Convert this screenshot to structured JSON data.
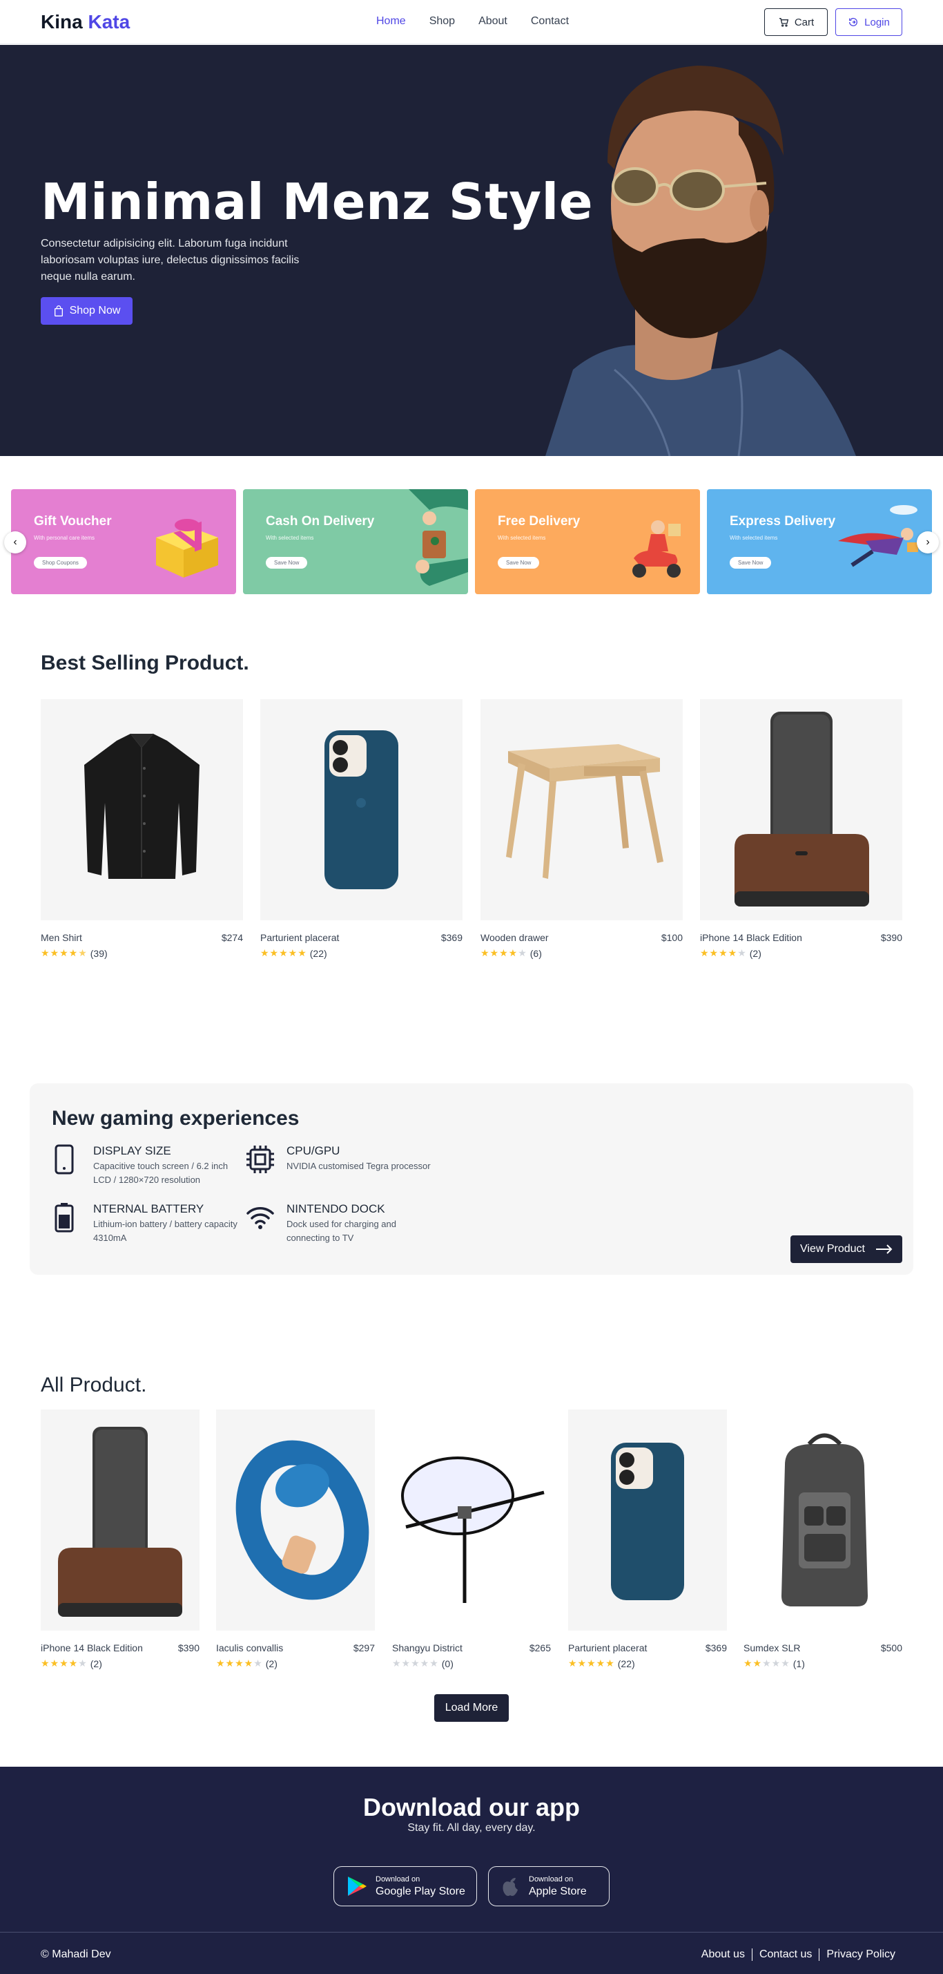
{
  "nav": {
    "logo_first": "Kina",
    "logo_second": "Kata",
    "links": [
      "Home",
      "Shop",
      "About",
      "Contact"
    ],
    "cart_label": "Cart",
    "login_label": "Login"
  },
  "hero": {
    "title": "Minimal Menz Style",
    "description": "Consectetur adipisicing elit. Laborum fuga incidunt laboriosam voluptas iure, delectus dignissimos facilis neque nulla earum.",
    "cta": "Shop Now"
  },
  "promos": [
    {
      "title": "Gift Voucher",
      "subtitle": "With personal care items",
      "button": "Shop Coupons",
      "color": "#e47fd1"
    },
    {
      "title": "Cash On Delivery",
      "subtitle": "With selected items",
      "button": "Save Now",
      "color": "#7fcaa5"
    },
    {
      "title": "Free Delivery",
      "subtitle": "With selected items",
      "button": "Save Now",
      "color": "#fdaa5d"
    },
    {
      "title": "Express Delivery",
      "subtitle": "With selected items",
      "button": "Save Now",
      "color": "#5fb4ee"
    }
  ],
  "best_selling": {
    "title": "Best Selling Product.",
    "products": [
      {
        "name": "Men Shirt",
        "price": "$274",
        "rating": 4.5,
        "reviews": "(39)"
      },
      {
        "name": "Parturient placerat",
        "price": "$369",
        "rating": 5,
        "reviews": "(22)"
      },
      {
        "name": "Wooden drawer",
        "price": "$100",
        "rating": 4,
        "reviews": "(6)"
      },
      {
        "name": "iPhone 14 Black Edition",
        "price": "$390",
        "rating": 4,
        "reviews": "(2)"
      }
    ]
  },
  "gaming": {
    "title": "New gaming experiences",
    "features": [
      {
        "title": "DISPLAY SIZE",
        "desc": "Capacitive touch screen / 6.2 inch LCD / 1280×720 resolution",
        "icon": "phone-icon"
      },
      {
        "title": "CPU/GPU",
        "desc": "NVIDIA customised Tegra processor",
        "icon": "cpu-icon"
      },
      {
        "title": "NTERNAL BATTERY",
        "desc": "Lithium-ion battery / battery capacity 4310mA",
        "icon": "battery-icon"
      },
      {
        "title": "NINTENDO DOCK",
        "desc": "Dock used for charging and connecting to TV",
        "icon": "wifi-icon"
      }
    ],
    "button": "View Product"
  },
  "all_products": {
    "title": "All Product.",
    "products": [
      {
        "name": "iPhone 14 Black Edition",
        "price": "$390",
        "rating": 4,
        "reviews": "(2)"
      },
      {
        "name": "Iaculis convallis",
        "price": "$297",
        "rating": 4,
        "reviews": "(2)"
      },
      {
        "name": "Shangyu District",
        "price": "$265",
        "rating": 0,
        "reviews": "(0)"
      },
      {
        "name": "Parturient placerat",
        "price": "$369",
        "rating": 5,
        "reviews": "(22)"
      },
      {
        "name": "Sumdex SLR",
        "price": "$500",
        "rating": 2,
        "reviews": "(1)"
      }
    ],
    "load_more": "Load More"
  },
  "footer": {
    "title": "Download our app",
    "tagline": "Stay fit. All day, every day.",
    "google": {
      "small": "Download on",
      "large": "Google Play Store"
    },
    "apple": {
      "small": "Download on",
      "large": "Apple Store"
    },
    "copyright": "© Mahadi Dev",
    "links": [
      "About us",
      "Contact us",
      "Privacy Policy"
    ]
  },
  "colors": {
    "accent": "#4f46e5",
    "dark": "#1e2237",
    "star": "#fbbf24"
  }
}
